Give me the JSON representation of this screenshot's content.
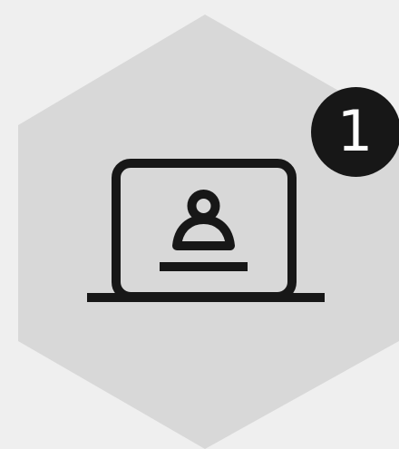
{
  "badge": {
    "number": "1"
  },
  "colors": {
    "background": "#efefef",
    "hexagon_fill": "#d8d8d8",
    "icon_stroke": "#171717",
    "badge_fill": "#171717",
    "badge_text": "#ffffff"
  },
  "icons": {
    "main": "laptop-user-icon"
  }
}
